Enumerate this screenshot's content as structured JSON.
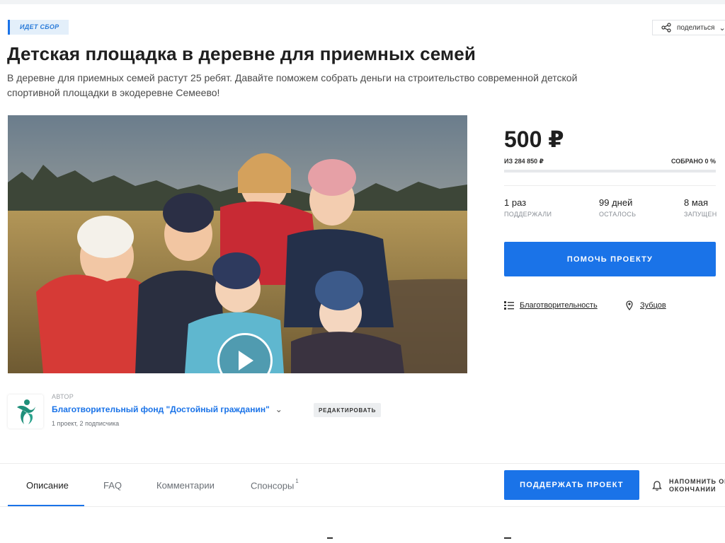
{
  "status_badge": "ИДЕТ СБОР",
  "share": {
    "label": "поделиться"
  },
  "title": "Детская площадка в деревне для приемных семей",
  "description": "В деревне для приемных семей растут 25 ребят. Давайте поможем собрать деньги на строительство современной детской спортивной площадки в экодеревне Семеево!",
  "funding": {
    "amount": "500 ₽",
    "goal": "ИЗ 284 850 ₽",
    "collected": "СОБРАНО 0 %",
    "progress_percent": 0
  },
  "stats": [
    {
      "value": "1 раз",
      "label": "ПОДДЕРЖАЛИ"
    },
    {
      "value": "99 дней",
      "label": "ОСТАЛОСЬ"
    },
    {
      "value": "8 мая",
      "label": "ЗАПУЩЕН"
    }
  ],
  "help_button": "ПОМОЧЬ ПРОЕКТУ",
  "category": {
    "label": "Благотворительность",
    "icon": "list-icon"
  },
  "location": {
    "label": "Зубцов",
    "icon": "map-pin-icon"
  },
  "author": {
    "caption": "АВТОР",
    "name": "Благотворительный фонд \"Достойный гражданин\"",
    "stats": "1 проект, 2 подписчика",
    "edit_label": "РЕДАКТИРОВАТЬ"
  },
  "tabs": [
    {
      "label": "Описание",
      "active": true
    },
    {
      "label": "FAQ"
    },
    {
      "label": "Комментарии"
    },
    {
      "label": "Спонсоры",
      "badge": "1"
    }
  ],
  "support_button": "ПОДДЕРЖАТЬ ПРОЕКТ",
  "remind": {
    "label": "НАПОМНИТЬ ОБ ОКОНЧАНИИ",
    "icon": "bell-icon"
  },
  "colors": {
    "accent": "#1a73e8",
    "badge_bg": "#e3effa",
    "text": "#1f1f1f",
    "muted": "#8a8f96"
  }
}
